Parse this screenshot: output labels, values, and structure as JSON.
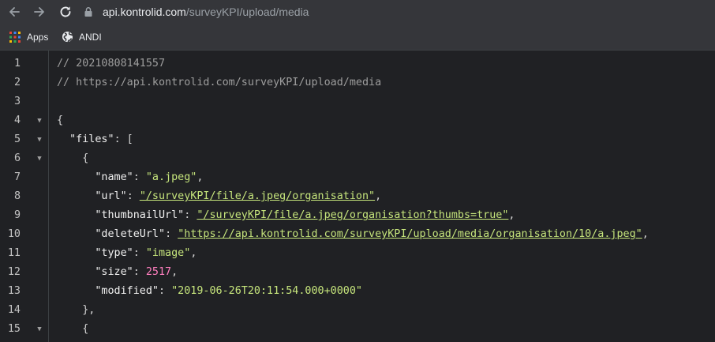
{
  "browser": {
    "url_host": "api.kontrolid.com",
    "url_path": "/surveyKPI/upload/media",
    "icons": {
      "back": "back-arrow-icon",
      "forward": "forward-arrow-icon",
      "reload": "reload-icon",
      "lock": "lock-icon"
    }
  },
  "bookmarks": [
    {
      "label": "Apps",
      "icon": "apps-grid-icon"
    },
    {
      "label": "ANDI",
      "icon": "globe-icon"
    }
  ],
  "code_lines": [
    {
      "n": "1",
      "fold": false,
      "tokens": [
        {
          "t": "cm",
          "v": "// 20210808141557"
        }
      ]
    },
    {
      "n": "2",
      "fold": false,
      "tokens": [
        {
          "t": "cm",
          "v": "// https://api.kontrolid.com/surveyKPI/upload/media"
        }
      ]
    },
    {
      "n": "3",
      "fold": false,
      "tokens": []
    },
    {
      "n": "4",
      "fold": true,
      "tokens": [
        {
          "t": "pun",
          "v": "{"
        }
      ]
    },
    {
      "n": "5",
      "fold": true,
      "tokens": [
        {
          "t": "pun",
          "v": "  "
        },
        {
          "t": "key",
          "v": "\"files\""
        },
        {
          "t": "pun",
          "v": ": ["
        }
      ]
    },
    {
      "n": "6",
      "fold": true,
      "tokens": [
        {
          "t": "pun",
          "v": "    {"
        }
      ]
    },
    {
      "n": "7",
      "fold": false,
      "tokens": [
        {
          "t": "pun",
          "v": "      "
        },
        {
          "t": "key",
          "v": "\"name\""
        },
        {
          "t": "pun",
          "v": ": "
        },
        {
          "t": "str",
          "v": "\"a.jpeg\""
        },
        {
          "t": "pun",
          "v": ","
        }
      ]
    },
    {
      "n": "8",
      "fold": false,
      "tokens": [
        {
          "t": "pun",
          "v": "      "
        },
        {
          "t": "key",
          "v": "\"url\""
        },
        {
          "t": "pun",
          "v": ": "
        },
        {
          "t": "link",
          "v": "\"/surveyKPI/file/a.jpeg/organisation\""
        },
        {
          "t": "pun",
          "v": ","
        }
      ]
    },
    {
      "n": "9",
      "fold": false,
      "tokens": [
        {
          "t": "pun",
          "v": "      "
        },
        {
          "t": "key",
          "v": "\"thumbnailUrl\""
        },
        {
          "t": "pun",
          "v": ": "
        },
        {
          "t": "link",
          "v": "\"/surveyKPI/file/a.jpeg/organisation?thumbs=true\""
        },
        {
          "t": "pun",
          "v": ","
        }
      ]
    },
    {
      "n": "10",
      "fold": false,
      "tokens": [
        {
          "t": "pun",
          "v": "      "
        },
        {
          "t": "key",
          "v": "\"deleteUrl\""
        },
        {
          "t": "pun",
          "v": ": "
        },
        {
          "t": "link",
          "v": "\"https://api.kontrolid.com/surveyKPI/upload/media/organisation/10/a.jpeg\""
        },
        {
          "t": "pun",
          "v": ","
        }
      ]
    },
    {
      "n": "11",
      "fold": false,
      "tokens": [
        {
          "t": "pun",
          "v": "      "
        },
        {
          "t": "key",
          "v": "\"type\""
        },
        {
          "t": "pun",
          "v": ": "
        },
        {
          "t": "str",
          "v": "\"image\""
        },
        {
          "t": "pun",
          "v": ","
        }
      ]
    },
    {
      "n": "12",
      "fold": false,
      "tokens": [
        {
          "t": "pun",
          "v": "      "
        },
        {
          "t": "key",
          "v": "\"size\""
        },
        {
          "t": "pun",
          "v": ": "
        },
        {
          "t": "num",
          "v": "2517"
        },
        {
          "t": "pun",
          "v": ","
        }
      ]
    },
    {
      "n": "13",
      "fold": false,
      "tokens": [
        {
          "t": "pun",
          "v": "      "
        },
        {
          "t": "key",
          "v": "\"modified\""
        },
        {
          "t": "pun",
          "v": ": "
        },
        {
          "t": "str",
          "v": "\"2019-06-26T20:11:54.000+0000\""
        }
      ]
    },
    {
      "n": "14",
      "fold": false,
      "tokens": [
        {
          "t": "pun",
          "v": "    },"
        }
      ]
    },
    {
      "n": "15",
      "fold": true,
      "tokens": [
        {
          "t": "pun",
          "v": "    {"
        }
      ]
    }
  ],
  "colors": {
    "background": "#202124",
    "toolbar": "#35363a",
    "string": "#c6e57c",
    "number": "#ff7fbf",
    "comment": "#9e9e9e"
  }
}
